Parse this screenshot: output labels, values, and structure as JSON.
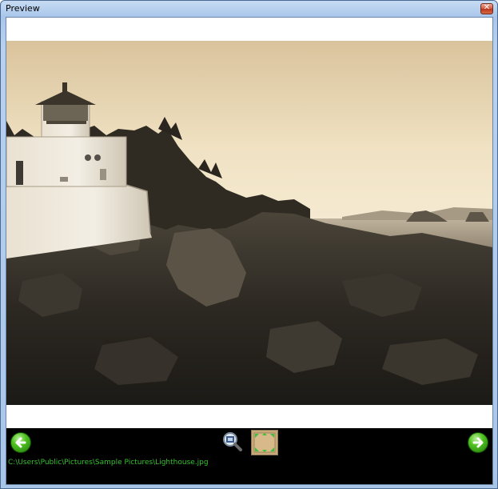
{
  "window": {
    "title": "Preview",
    "close_icon": "close-icon"
  },
  "image": {
    "subject": "lighthouse-photo"
  },
  "toolbar": {
    "prev_icon": "arrow-left-icon",
    "next_icon": "arrow-right-icon",
    "zoom_icon": "magnifier-zoom-icon",
    "fit_icon": "fit-to-window-icon",
    "file_path": "C:\\Users\\Public\\Pictures\\Sample Pictures\\Lighthouse.jpg"
  },
  "colors": {
    "bar_background": "#000000",
    "path_text": "#36c02e",
    "nav_green": "#4fc01f"
  }
}
